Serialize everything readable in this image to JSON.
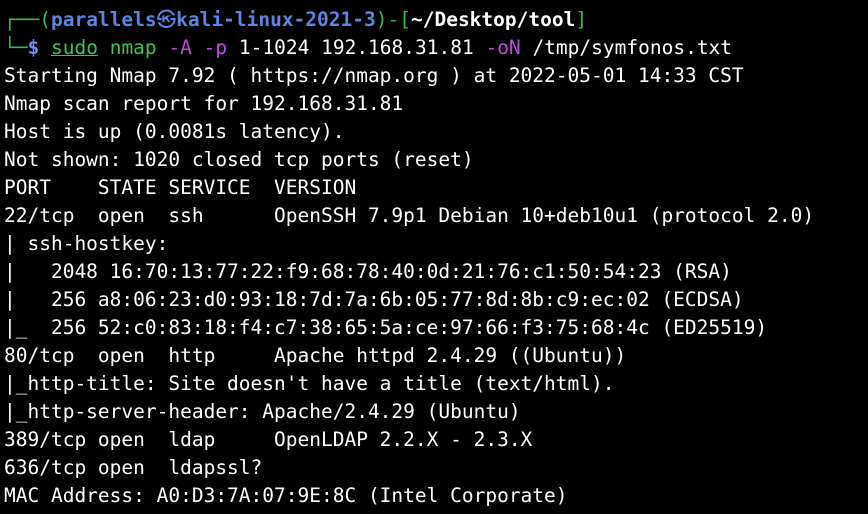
{
  "prompt": {
    "corner_top": "┌──(",
    "user": "parallels",
    "skull": "㉿",
    "host": "kali-linux-2021-3",
    "close_paren": ")-[",
    "path": "~/Desktop/tool",
    "close_bracket": "]",
    "corner_bottom": "└─",
    "dollar": "$",
    "cmd_sudo": "sudo",
    "cmd_nmap": "nmap",
    "flag_A": "-A",
    "flag_p": "-p",
    "ports": "1-1024",
    "target": "192.168.31.81",
    "flag_oN": "-oN",
    "outfile": "/tmp/symfonos.txt"
  },
  "output": [
    "Starting Nmap 7.92 ( https://nmap.org ) at 2022-05-01 14:33 CST",
    "Nmap scan report for 192.168.31.81",
    "Host is up (0.0081s latency).",
    "Not shown: 1020 closed tcp ports (reset)",
    "PORT    STATE SERVICE  VERSION",
    "22/tcp  open  ssh      OpenSSH 7.9p1 Debian 10+deb10u1 (protocol 2.0)",
    "| ssh-hostkey: ",
    "|   2048 16:70:13:77:22:f9:68:78:40:0d:21:76:c1:50:54:23 (RSA)",
    "|   256 a8:06:23:d0:93:18:7d:7a:6b:05:77:8d:8b:c9:ec:02 (ECDSA)",
    "|_  256 52:c0:83:18:f4:c7:38:65:5a:ce:97:66:f3:75:68:4c (ED25519)",
    "80/tcp  open  http     Apache httpd 2.4.29 ((Ubuntu))",
    "|_http-title: Site doesn't have a title (text/html).",
    "|_http-server-header: Apache/2.4.29 (Ubuntu)",
    "389/tcp open  ldap     OpenLDAP 2.2.X - 2.3.X",
    "636/tcp open  ldapssl?",
    "MAC Address: A0:D3:7A:07:9E:8C (Intel Corporate)"
  ],
  "colors": {
    "background": "#000000",
    "prompt_green": "#2fbf43",
    "prompt_blue": "#5a86e6",
    "flag_purple": "#c34be0",
    "text": "#ffffff"
  }
}
